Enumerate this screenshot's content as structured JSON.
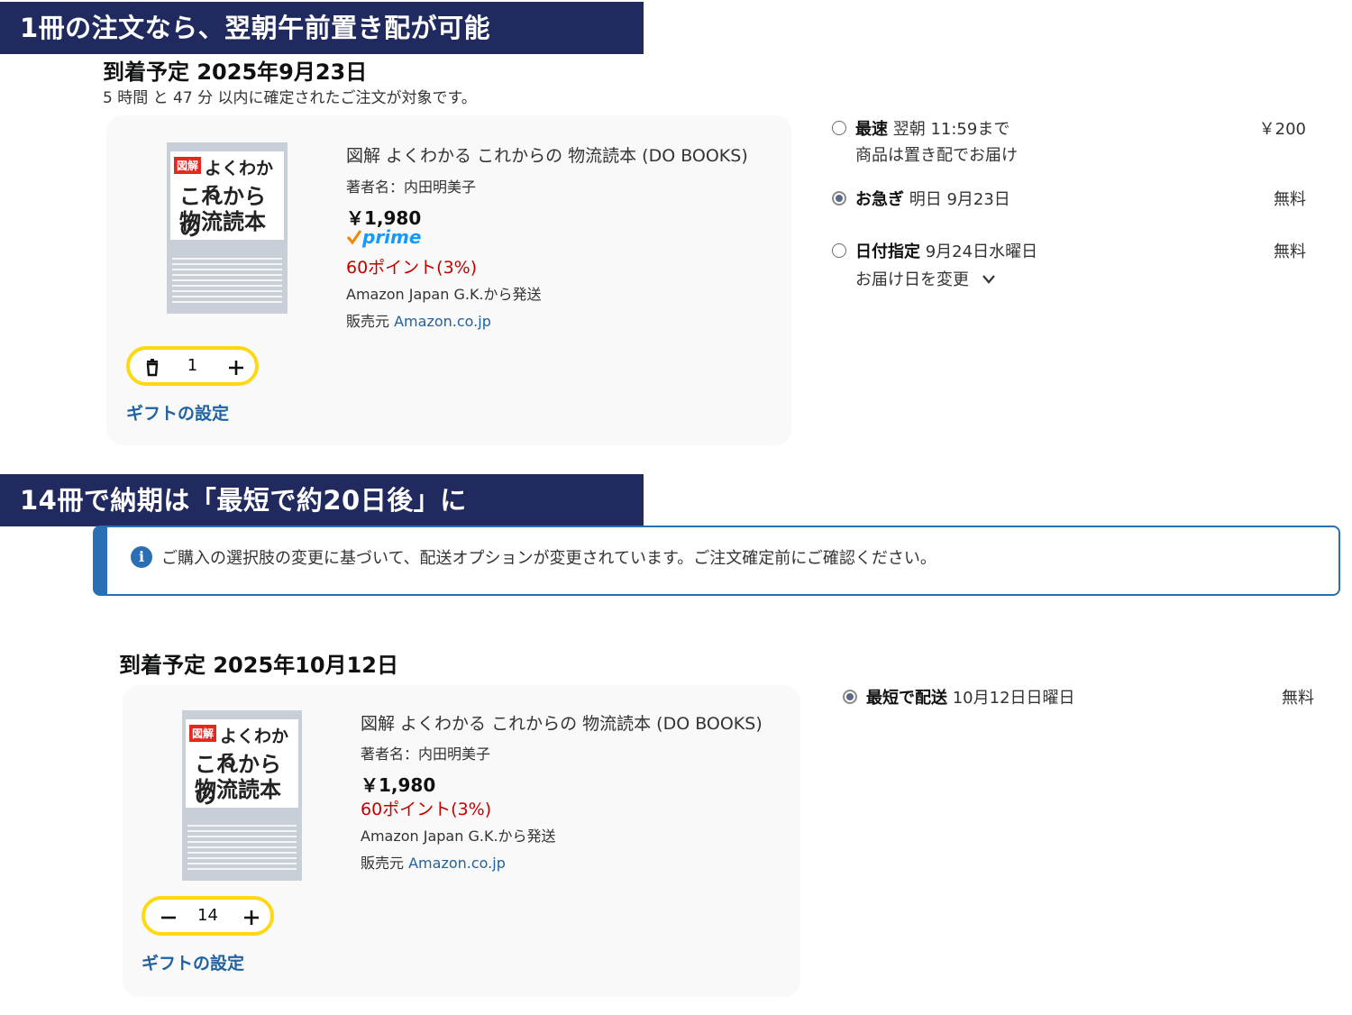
{
  "section1": {
    "banner": "1冊の注文なら、翌朝午前置き配が可能",
    "arrival": "到着予定 2025年9月23日",
    "countdown": "5 時間 と 47 分 以内に確定されたご注文が対象です。",
    "item": {
      "title": "図解 よくわかる これからの 物流読本 (DO BOOKS)",
      "author": "著者名：内田明美子",
      "price": "￥1,980",
      "prime_label": "prime",
      "points": "60ポイント(3%)",
      "shipper": "Amazon Japan G.K.から発送",
      "seller_prefix": "販売元",
      "seller": "Amazon.co.jp",
      "quantity": "1",
      "gift": "ギフトの設定"
    },
    "options": [
      {
        "label": "最速",
        "detail": "翌朝 11:59まで",
        "note": "商品は置き配でお届け",
        "fee": "￥200",
        "selected": false
      },
      {
        "label": "お急ぎ",
        "detail": "明日 9月23日",
        "fee": "無料",
        "selected": true
      },
      {
        "label": "日付指定",
        "detail": "9月24日水曜日",
        "note": "お届け日を変更",
        "fee": "無料",
        "selected": false
      }
    ]
  },
  "section2": {
    "banner": "14冊で納期は「最短で約20日後」に",
    "notice": "ご購入の選択肢の変更に基づいて、配送オプションが変更されています。ご注文確定前にご確認ください。",
    "arrival": "到着予定 2025年10月12日",
    "item": {
      "title": "図解 よくわかる これからの 物流読本 (DO BOOKS)",
      "author": "著者名：内田明美子",
      "price": "￥1,980",
      "points": "60ポイント(3%)",
      "shipper": "Amazon Japan G.K.から発送",
      "seller_prefix": "販売元",
      "seller": "Amazon.co.jp",
      "quantity": "14",
      "gift": "ギフトの設定"
    },
    "options": [
      {
        "label": "最短で配送",
        "detail": "10月12日日曜日",
        "fee": "無料",
        "selected": true
      }
    ]
  },
  "book_cover": {
    "badge": "図解",
    "line1": "よくわかる",
    "line2": "これからの",
    "line3": "物流読本"
  },
  "colors": {
    "banner": "#212a5e",
    "accent_yellow": "#ffd814",
    "link": "#2162a1",
    "points": "#c40000",
    "info": "#2a6fb3"
  }
}
